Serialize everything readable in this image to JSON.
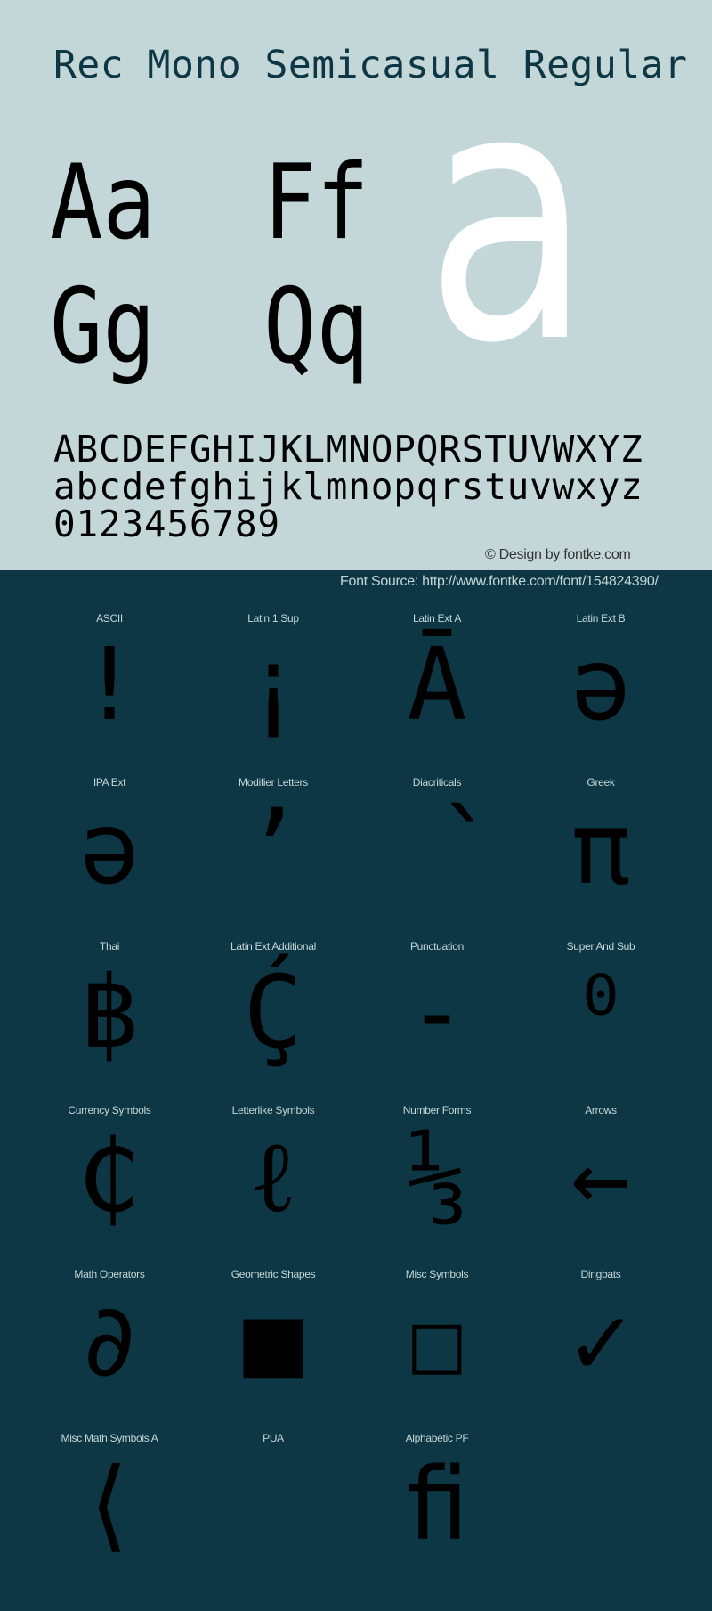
{
  "preview": {
    "title": "Rec Mono Semicasual Regular",
    "pairs": [
      "Aa",
      "Ff",
      "Gg",
      "Qq"
    ],
    "hero_glyph": "a",
    "uppercase": "ABCDEFGHIJKLMNOPQRSTUVWXYZ",
    "lowercase": "abcdefghijklmnopqrstuvwxyz",
    "digits": "0123456789",
    "credit": "© Design by fontke.com",
    "colors": {
      "light_bg": "#c4d7d8",
      "dark_bg": "#0d3744",
      "title": "#0d3744",
      "hero_glyph": "#ffffff",
      "glyph": "#000000"
    }
  },
  "source": {
    "text": "Font Source: http://www.fontke.com/font/154824390/"
  },
  "blocks": [
    {
      "label": "ASCII",
      "glyph": "!"
    },
    {
      "label": "Latin 1 Sup",
      "glyph": "¡"
    },
    {
      "label": "Latin Ext A",
      "glyph": "Ā"
    },
    {
      "label": "Latin Ext B",
      "glyph": "ə"
    },
    {
      "label": "IPA Ext",
      "glyph": "ə"
    },
    {
      "label": "Modifier Letters",
      "glyph": "ʼ"
    },
    {
      "label": "Diacriticals",
      "glyph": "̀"
    },
    {
      "label": "Greek",
      "glyph": "π"
    },
    {
      "label": "Thai",
      "glyph": "฿"
    },
    {
      "label": "Latin Ext Additional",
      "glyph": "Ḉ"
    },
    {
      "label": "Punctuation",
      "glyph": "‐"
    },
    {
      "label": "Super And Sub",
      "glyph": "⁰"
    },
    {
      "label": "Currency Symbols",
      "glyph": "₵"
    },
    {
      "label": "Letterlike Symbols",
      "glyph": "ℓ"
    },
    {
      "label": "Number Forms",
      "glyph": "⅓"
    },
    {
      "label": "Arrows",
      "glyph": "←"
    },
    {
      "label": "Math Operators",
      "glyph": "∂"
    },
    {
      "label": "Geometric Shapes",
      "glyph": "■"
    },
    {
      "label": "Misc Symbols",
      "glyph": "☐"
    },
    {
      "label": "Dingbats",
      "glyph": "✓"
    },
    {
      "label": "Misc Math Symbols A",
      "glyph": "⟨"
    },
    {
      "label": "PUA",
      "glyph": ""
    },
    {
      "label": "Alphabetic PF",
      "glyph": "ﬁ"
    }
  ]
}
